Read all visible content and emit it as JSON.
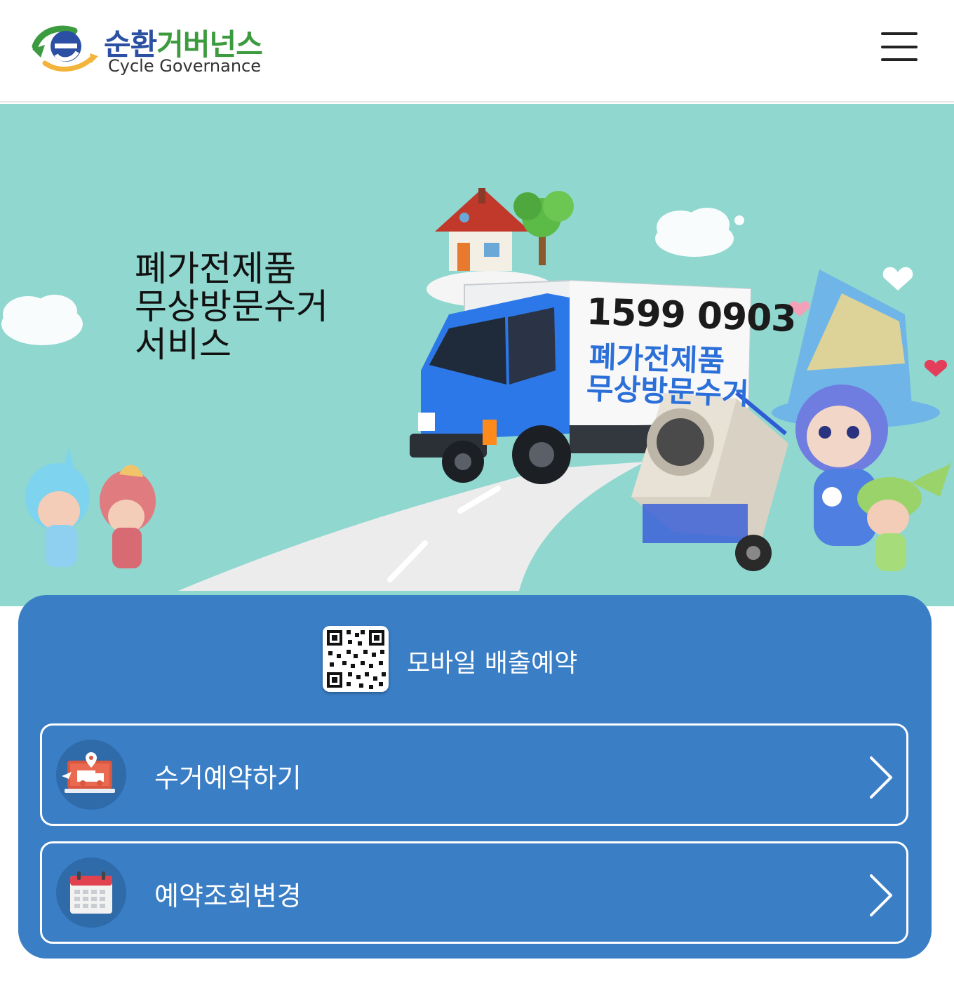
{
  "header": {
    "logo_ko_part1": "순환",
    "logo_ko_part2": "거버넌스",
    "logo_en": "Cycle Governance",
    "menu_icon": "hamburger-menu-icon"
  },
  "hero": {
    "title_lines": [
      "폐가전제품",
      "무상방문수거",
      "서비스"
    ],
    "truck_phone": "1599 0903",
    "truck_line1": "폐가전제품",
    "truck_line2": "무상방문수거"
  },
  "panel": {
    "qr_icon": "qr-code-icon",
    "mobile_label": "모바일 배출예약",
    "actions": [
      {
        "label": "수거예약하기",
        "icon": "truck-reservation-icon",
        "arrow": "chevron-right-icon"
      },
      {
        "label": "예약조회변경",
        "icon": "calendar-icon",
        "arrow": "chevron-right-icon"
      }
    ]
  },
  "colors": {
    "hero_bg": "#8fd7cf",
    "panel_bg": "#3a7ec6",
    "brand_blue": "#2b4fa2",
    "brand_green": "#3c9a3f",
    "truck_text_blue": "#2b6fd8"
  }
}
